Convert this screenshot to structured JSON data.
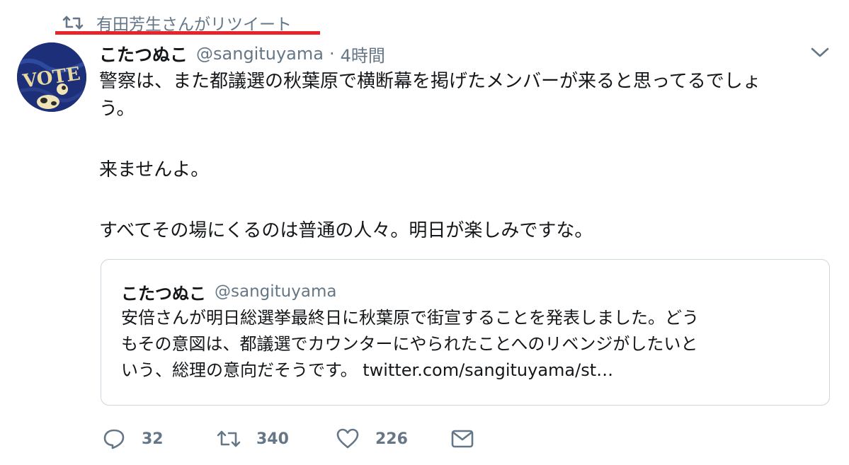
{
  "context": {
    "retweeted_by": "有田芳生さんがリツイート",
    "highlight_color": "#e8232a"
  },
  "tweet": {
    "display_name": "こたつぬこ",
    "handle": "@sangituyama",
    "separator": "·",
    "time": "4時間",
    "text_lines": [
      "警察は、また都議選の秋葉原で横断幕を掲げたメンバーが来ると思ってるでしょ",
      "う。",
      "来ませんよ。",
      "すべてその場にくるのは普通の人々。明日が楽しみですな。"
    ],
    "avatar_text": "VOTE"
  },
  "quoted": {
    "display_name": "こたつぬこ",
    "handle": "@sangituyama",
    "text_lines": [
      "安倍さんが明日総選挙最終日に秋葉原で街宣することを発表しました。どう",
      "もその意図は、都議選でカウンターにやられたことへのリベンジがしたいと",
      "いう、総理の意向だそうです。"
    ],
    "link": "twitter.com/sangituyama/st…"
  },
  "actions": {
    "reply_count": "32",
    "retweet_count": "340",
    "like_count": "226"
  },
  "icons": {
    "retweet_context": "retweet-icon",
    "menu": "chevron-down-icon",
    "reply": "reply-icon",
    "retweet": "retweet-icon",
    "like": "heart-icon",
    "message": "envelope-icon"
  },
  "colors": {
    "text": "#14171a",
    "secondary": "#657786",
    "border": "#ccd6dd"
  }
}
